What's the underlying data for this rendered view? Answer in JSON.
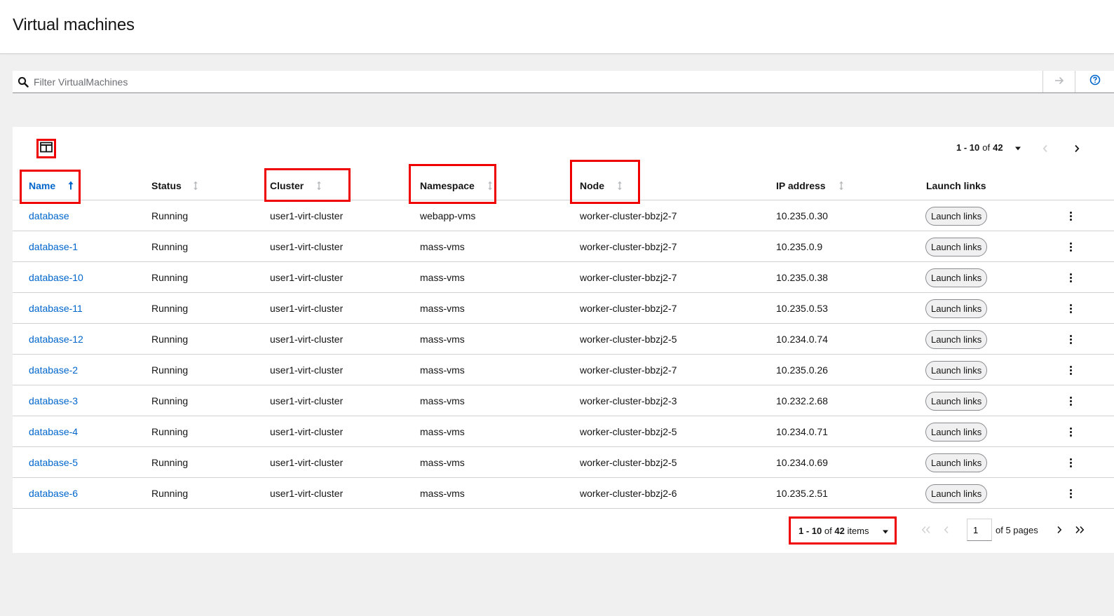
{
  "page": {
    "title": "Virtual machines"
  },
  "filter": {
    "placeholder": "Filter VirtualMachines"
  },
  "toolbar": {
    "range": "1 - 10",
    "of": "of",
    "total": "42"
  },
  "columns": [
    {
      "key": "name",
      "label": "Name",
      "sortable": true,
      "sorted": "asc"
    },
    {
      "key": "status",
      "label": "Status",
      "sortable": true
    },
    {
      "key": "cluster",
      "label": "Cluster",
      "sortable": true
    },
    {
      "key": "namespace",
      "label": "Namespace",
      "sortable": true
    },
    {
      "key": "node",
      "label": "Node",
      "sortable": true
    },
    {
      "key": "ip",
      "label": "IP address",
      "sortable": true
    },
    {
      "key": "launch",
      "label": "Launch links",
      "sortable": false
    }
  ],
  "rows": [
    {
      "name": "database",
      "status": "Running",
      "cluster": "user1-virt-cluster",
      "namespace": "webapp-vms",
      "node": "worker-cluster-bbzj2-7",
      "ip": "10.235.0.30",
      "launch": "Launch links"
    },
    {
      "name": "database-1",
      "status": "Running",
      "cluster": "user1-virt-cluster",
      "namespace": "mass-vms",
      "node": "worker-cluster-bbzj2-7",
      "ip": "10.235.0.9",
      "launch": "Launch links"
    },
    {
      "name": "database-10",
      "status": "Running",
      "cluster": "user1-virt-cluster",
      "namespace": "mass-vms",
      "node": "worker-cluster-bbzj2-7",
      "ip": "10.235.0.38",
      "launch": "Launch links"
    },
    {
      "name": "database-11",
      "status": "Running",
      "cluster": "user1-virt-cluster",
      "namespace": "mass-vms",
      "node": "worker-cluster-bbzj2-7",
      "ip": "10.235.0.53",
      "launch": "Launch links"
    },
    {
      "name": "database-12",
      "status": "Running",
      "cluster": "user1-virt-cluster",
      "namespace": "mass-vms",
      "node": "worker-cluster-bbzj2-5",
      "ip": "10.234.0.74",
      "launch": "Launch links"
    },
    {
      "name": "database-2",
      "status": "Running",
      "cluster": "user1-virt-cluster",
      "namespace": "mass-vms",
      "node": "worker-cluster-bbzj2-7",
      "ip": "10.235.0.26",
      "launch": "Launch links"
    },
    {
      "name": "database-3",
      "status": "Running",
      "cluster": "user1-virt-cluster",
      "namespace": "mass-vms",
      "node": "worker-cluster-bbzj2-3",
      "ip": "10.232.2.68",
      "launch": "Launch links"
    },
    {
      "name": "database-4",
      "status": "Running",
      "cluster": "user1-virt-cluster",
      "namespace": "mass-vms",
      "node": "worker-cluster-bbzj2-5",
      "ip": "10.234.0.71",
      "launch": "Launch links"
    },
    {
      "name": "database-5",
      "status": "Running",
      "cluster": "user1-virt-cluster",
      "namespace": "mass-vms",
      "node": "worker-cluster-bbzj2-5",
      "ip": "10.234.0.69",
      "launch": "Launch links"
    },
    {
      "name": "database-6",
      "status": "Running",
      "cluster": "user1-virt-cluster",
      "namespace": "mass-vms",
      "node": "worker-cluster-bbzj2-6",
      "ip": "10.235.2.51",
      "launch": "Launch links"
    }
  ],
  "pagination": {
    "range": "1 - 10",
    "of": "of",
    "total": "42",
    "items_label": "items",
    "current_page": "1",
    "pages_text": "of 5 pages"
  },
  "icons": {
    "search": "search-icon",
    "go": "arrow-right-icon",
    "help": "help-icon",
    "columns": "columns-icon",
    "sort": "sort-icon",
    "kebab": "kebab-icon"
  },
  "colors": {
    "link": "#0066cc",
    "highlight": "#ee0000",
    "border": "#d2d2d2",
    "background": "#f0f0f0"
  }
}
